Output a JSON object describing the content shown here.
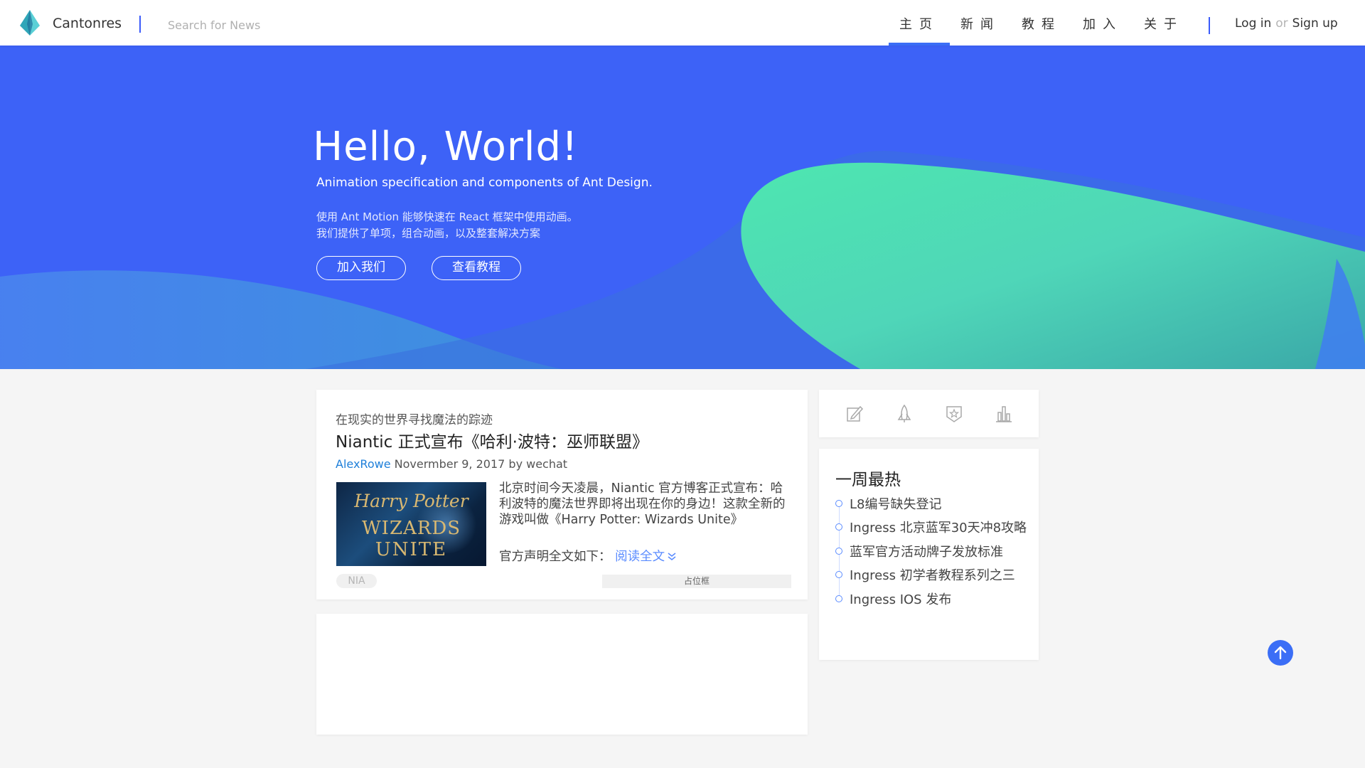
{
  "header": {
    "brand": "Cantonres",
    "search_placeholder": "Search for News",
    "nav": [
      {
        "label": "主页",
        "active": true
      },
      {
        "label": "新闻",
        "active": false
      },
      {
        "label": "教程",
        "active": false
      },
      {
        "label": "加入",
        "active": false
      },
      {
        "label": "关于",
        "active": false
      }
    ],
    "login": "Log in",
    "or": "or",
    "signup": "Sign up",
    "accent_color": "#3b6ef6"
  },
  "hero": {
    "title": "Hello, World!",
    "subtitle": "Animation specification and components of Ant Design.",
    "desc_line1": "使用 Ant Motion 能够快速在 React 框架中使用动画。",
    "desc_line2": "我们提供了单项，组合动画，以及整套解决方案",
    "btn_join": "加入我们",
    "btn_tutorial": "查看教程",
    "bg_color": "#3d62f7"
  },
  "article": {
    "kicker": "在现实的世界寻找魔法的踪迹",
    "title": "Niantic 正式宣布《哈利·波特：巫师联盟》",
    "author": "AlexRowe",
    "meta": " Novermber 9, 2017 by wechat",
    "thumb_line1": "Harry Potter",
    "thumb_line2": "WIZARDS",
    "thumb_line3": "UNITE",
    "body": "北京时间今天凌晨，Niantic 官方博客正式宣布：哈利波特的魔法世界即将出现在你的身边！这款全新的游戏叫做《Harry Potter: Wizards Unite》",
    "official": "官方声明全文如下：",
    "read_more": "阅读全文",
    "tag": "NIA",
    "placeholder": "占位框"
  },
  "sidebar": {
    "icons": [
      "edit-icon",
      "rocket-icon",
      "star-shield-icon",
      "bar-chart-icon"
    ],
    "hot_title": "一周最热",
    "hot_items": [
      "L8编号缺失登记",
      "Ingress 北京蓝军30天冲8攻略",
      "蓝军官方活动牌子发放标准",
      "Ingress 初学者教程系列之三",
      "Ingress IOS 发布"
    ]
  }
}
